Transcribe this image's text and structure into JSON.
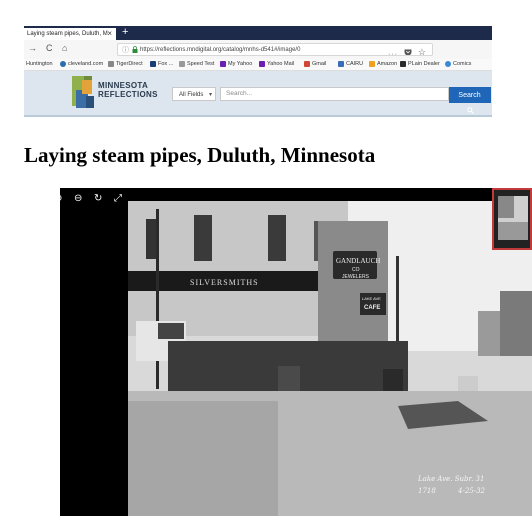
{
  "browser": {
    "tab_title": "Laying steam pipes, Duluth, M",
    "tab_close": "×",
    "new_tab": "+",
    "url": "https://reflections.mndigital.org/catalog/mnhs-d541#/image/0",
    "nav_back": "→",
    "nav_reload": "C",
    "nav_home": "⌂",
    "url_info_icon": "ⓘ",
    "url_lock_icon": "🔒",
    "url_menu": "···",
    "star_icon": "☆",
    "bookmarks": [
      {
        "label": "Huntington",
        "color": "#ffffff"
      },
      {
        "label": "cleveland.com",
        "color": "#2a6db0"
      },
      {
        "label": "TigerDirect",
        "color": "#888888"
      },
      {
        "label": "Fox ...",
        "color": "#1a3d7a"
      },
      {
        "label": "Speed Test",
        "color": "#999999"
      },
      {
        "label": "My Yahoo",
        "color": "#6b1fb0"
      },
      {
        "label": "Yahoo Mail",
        "color": "#6b1fb0"
      },
      {
        "label": "Gmail",
        "color": "#d14836"
      },
      {
        "label": "CAIRU",
        "color": "#3a6db8"
      },
      {
        "label": "Amazon",
        "color": "#f0a020"
      },
      {
        "label": "PLain Dealer",
        "color": "#2a2a2a"
      },
      {
        "label": "Comics",
        "color": "#3a8ad8"
      }
    ]
  },
  "site": {
    "logo_line1": "MINNESOTA",
    "logo_line2": "REFLECTIONS",
    "field_select": "All Fields",
    "search_placeholder": "Search...",
    "search_button": "Search"
  },
  "page_title": "Laying steam pipes, Duluth, Minnesota",
  "viewer": {
    "zoom_in_icon": "⊕",
    "zoom_out_icon": "⊖",
    "rotate_icon": "↻",
    "fullscreen_icon": "⤢",
    "photo_signs": {
      "shop": "SILVERSMITHS",
      "sign1": "GANDLAUCH",
      "sign1b": "CO",
      "sign2": "JEWELERS",
      "sign3": "LAKE AVE",
      "sign4": "CAFE",
      "caption1": "Lake Ave. Subr. 31",
      "caption2": "1718",
      "caption3": "4-25-32"
    }
  }
}
